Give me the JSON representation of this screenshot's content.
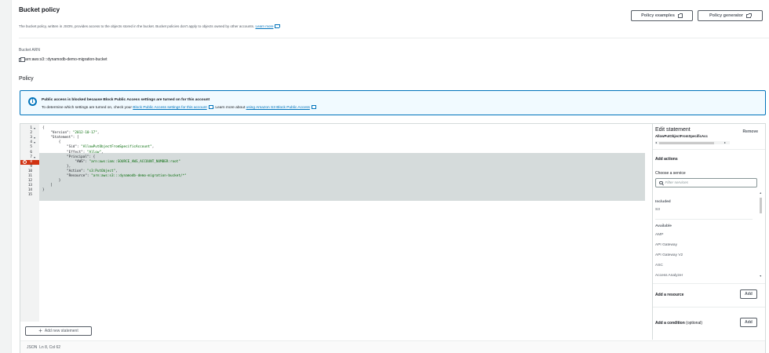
{
  "header": {
    "title": "Bucket policy",
    "description": "The bucket policy, written in JSON, provides access to the objects stored in the bucket. Bucket policies don't apply to objects owned by other accounts.",
    "learn_more": "Learn more",
    "policy_examples_label": "Policy examples",
    "policy_generator_label": "Policy generator"
  },
  "arn": {
    "label": "Bucket ARN",
    "value": "arn:aws:s3:::dynamodb-demo-migration-bucket"
  },
  "policy_heading": "Policy",
  "alert": {
    "title": "Public access is blocked because Block Public Access settings are turned on for this account",
    "body_prefix": "To determine which settings are turned on, check your",
    "body_link1": "Block Public Access settings for this account",
    "body_mid": ". Learn more about",
    "body_link2": "using Amazon S3 Block Public Access"
  },
  "editor": {
    "lines": [
      {
        "n": "1",
        "fold": "▼",
        "text": "{"
      },
      {
        "n": "2",
        "fold": "",
        "key": "    \"Version\": ",
        "str": "\"2012-10-17\"",
        "tail": ","
      },
      {
        "n": "3",
        "fold": "▼",
        "key": "    \"Statement\": [",
        "str": "",
        "tail": ""
      },
      {
        "n": "4",
        "fold": "▼",
        "text": "        {"
      },
      {
        "n": "5",
        "fold": "",
        "key": "            \"Sid\": ",
        "str": "\"AllowPutObjectFromSpecificAccount\"",
        "tail": ","
      },
      {
        "n": "6",
        "fold": "",
        "key": "            \"Effect\": ",
        "str": "\"Allow\"",
        "tail": ","
      },
      {
        "n": "7",
        "fold": "▼",
        "key": "            \"Principal\": {",
        "str": "",
        "tail": ""
      },
      {
        "n": "8",
        "fold": "",
        "key": "                \"AWS\": ",
        "str": "\"arn:aws:iam::SOURCE_AWS_ACCOUNT_NUMBER:root\"",
        "tail": ""
      },
      {
        "n": "9",
        "fold": "",
        "text": "            },"
      },
      {
        "n": "10",
        "fold": "",
        "key": "            \"Action\": ",
        "str": "\"s3:PutObject\"",
        "tail": ","
      },
      {
        "n": "11",
        "fold": "",
        "key": "            \"Resource\": ",
        "str": "\"arn:aws:s3:::dynamodb-demo-migration-bucket/*\"",
        "tail": ""
      },
      {
        "n": "12",
        "fold": "",
        "text": "        }"
      },
      {
        "n": "13",
        "fold": "",
        "text": "    ]"
      },
      {
        "n": "14",
        "fold": "",
        "text": "}"
      },
      {
        "n": "15",
        "fold": "",
        "text": ""
      }
    ],
    "error_line": "8",
    "add_statement_label": "Add new statement",
    "status_mode": "JSON",
    "status_position": "Ln 8, Col 62"
  },
  "side_panel": {
    "title": "Edit statement",
    "statement_id": "AllowPutObjectFromSpecificAcc",
    "remove_label": "Remove",
    "add_actions_label": "Add actions",
    "choose_service_label": "Choose a service",
    "filter_placeholder": "Filter services",
    "included_label": "Included",
    "included_services": [
      "S3"
    ],
    "available_label": "Available",
    "available_services": [
      "AMP",
      "API Gateway",
      "API Gateway V2",
      "ASC",
      "Access Analyzer"
    ],
    "add_resource_label": "Add a resource",
    "add_resource_button": "Add",
    "add_condition_label": "Add a condition",
    "add_condition_optional": "(optional)",
    "add_condition_button": "Add"
  },
  "icons": {
    "external": "external-link-icon",
    "copy": "copy-icon",
    "info": "info-icon",
    "error": "error-icon",
    "search": "search-icon",
    "plus": "plus-icon"
  },
  "colors": {
    "link": "#0073bb",
    "error": "#d13212",
    "selection": "#d5dbdb",
    "string": "#036a07"
  }
}
